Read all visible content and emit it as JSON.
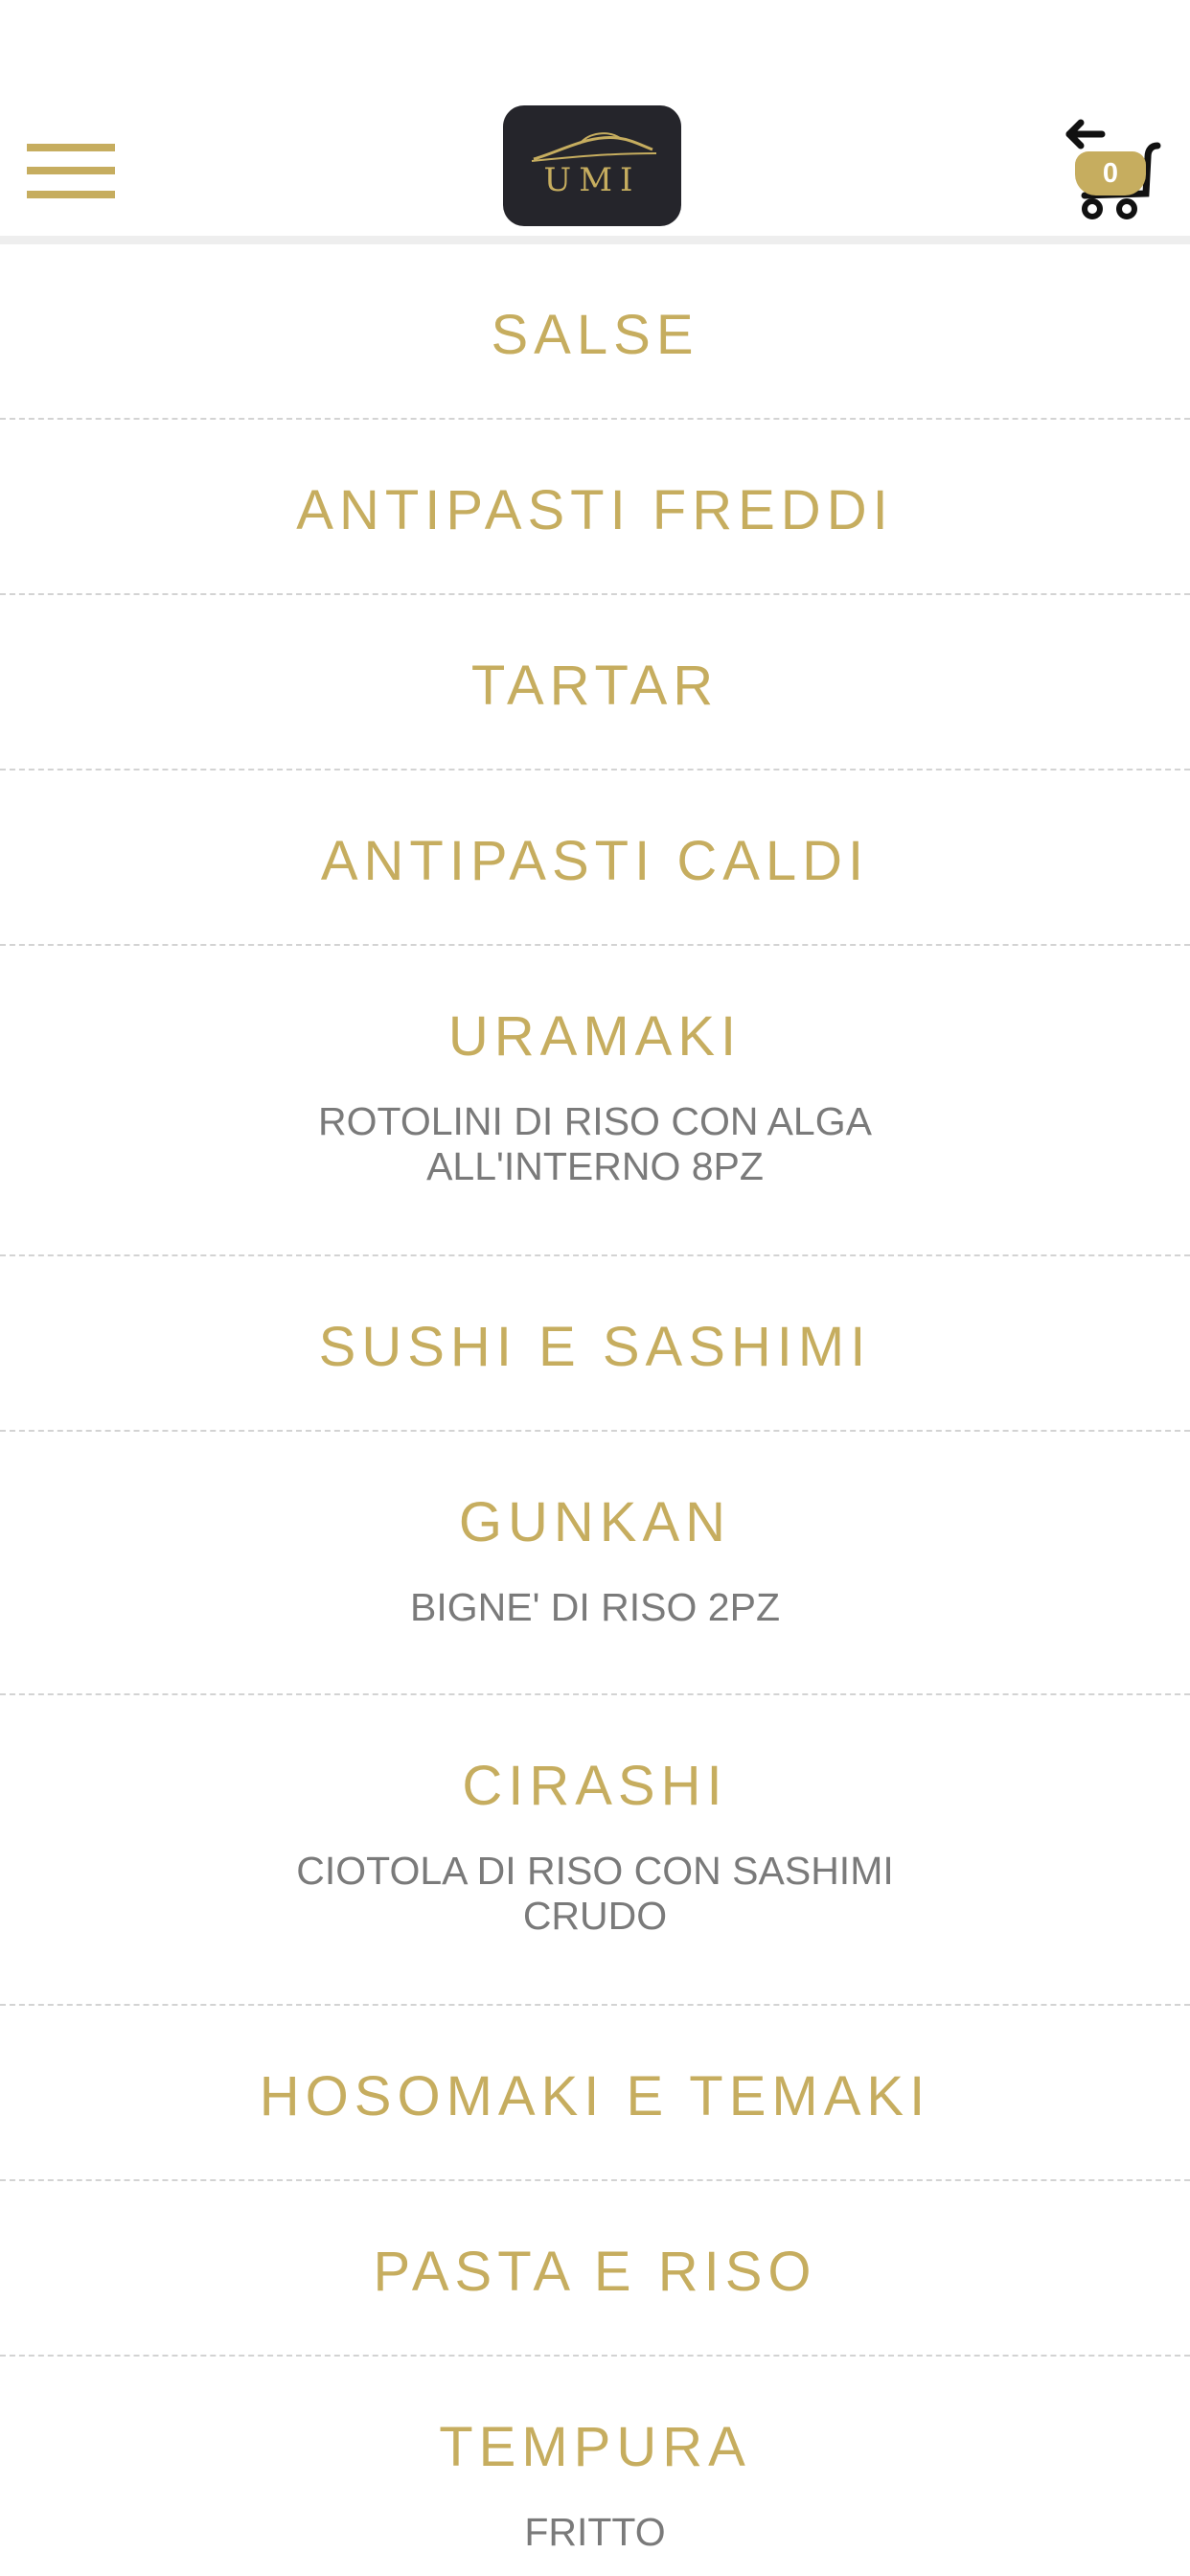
{
  "header": {
    "logo_text": "UMI",
    "cart_count": "0"
  },
  "icons": {
    "menu": "hamburger-menu-icon",
    "cart": "shopping-cart-icon",
    "back": "back-arrow-icon"
  },
  "colors": {
    "accent": "#c6ad5f",
    "logo_bg": "#25252b",
    "description": "#7a7a7a",
    "divider": "#d3d3d3"
  },
  "categories": [
    {
      "title": "SALSE",
      "description": ""
    },
    {
      "title": "ANTIPASTI FREDDI",
      "description": ""
    },
    {
      "title": "TARTAR",
      "description": ""
    },
    {
      "title": "ANTIPASTI CALDI",
      "description": ""
    },
    {
      "title": "URAMAKI",
      "description": "ROTOLINI DI RISO CON ALGA ALL'INTERNO 8PZ"
    },
    {
      "title": "SUSHI E SASHIMI",
      "description": ""
    },
    {
      "title": "GUNKAN",
      "description": "BIGNE' DI RISO 2PZ"
    },
    {
      "title": "CIRASHI",
      "description": "CIOTOLA DI RISO CON SASHIMI CRUDO"
    },
    {
      "title": "HOSOMAKI E TEMAKI",
      "description": ""
    },
    {
      "title": "PASTA E RISO",
      "description": ""
    },
    {
      "title": "TEMPURA",
      "description": "FRITTO"
    }
  ]
}
